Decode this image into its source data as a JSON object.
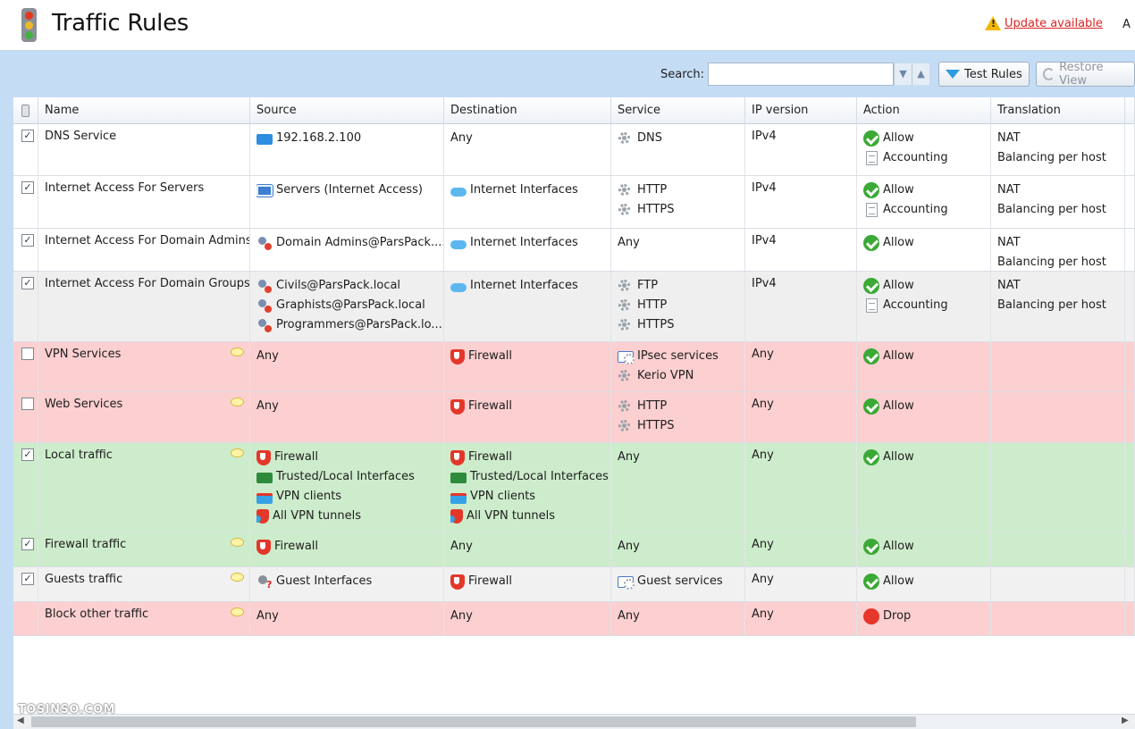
{
  "header": {
    "title": "Traffic Rules",
    "update_link": "Update available",
    "cut_text": "A"
  },
  "toolbar": {
    "search_label": "Search:",
    "search_value": "",
    "test_rules": "Test Rules",
    "restore_view": "Restore View"
  },
  "columns": [
    "Name",
    "Source",
    "Destination",
    "Service",
    "IP version",
    "Action",
    "Translation"
  ],
  "rows": [
    {
      "name": "DNS Service",
      "checked": true,
      "source": [
        "192.168.2.100"
      ],
      "destination": [
        "Any"
      ],
      "service": [
        "DNS"
      ],
      "ip": "IPv4",
      "action": [
        "Allow",
        "Accounting"
      ],
      "translation": [
        "NAT",
        "Balancing per host"
      ]
    },
    {
      "name": "Internet Access For Servers",
      "checked": true,
      "source": [
        "Servers (Internet Access)"
      ],
      "destination": [
        "Internet Interfaces"
      ],
      "service": [
        "HTTP",
        "HTTPS"
      ],
      "ip": "IPv4",
      "action": [
        "Allow",
        "Accounting"
      ],
      "translation": [
        "NAT",
        "Balancing per host"
      ]
    },
    {
      "name": "Internet Access For Domain Admins",
      "checked": true,
      "source": [
        "Domain Admins@ParsPack...."
      ],
      "destination": [
        "Internet Interfaces"
      ],
      "service": [
        "Any"
      ],
      "ip": "IPv4",
      "action": [
        "Allow"
      ],
      "translation": [
        "NAT",
        "Balancing per host"
      ]
    },
    {
      "name": "Internet Access For Domain Groups",
      "checked": true,
      "source": [
        "Civils@ParsPack.local",
        "Graphists@ParsPack.local",
        "Programmers@ParsPack.lo..."
      ],
      "destination": [
        "Internet Interfaces"
      ],
      "service": [
        "FTP",
        "HTTP",
        "HTTPS"
      ],
      "ip": "IPv4",
      "action": [
        "Allow",
        "Accounting"
      ],
      "translation": [
        "NAT",
        "Balancing per host"
      ]
    },
    {
      "name": "VPN Services",
      "checked": false,
      "source": [
        "Any"
      ],
      "destination": [
        "Firewall"
      ],
      "service": [
        "IPsec services",
        "Kerio VPN"
      ],
      "ip": "Any",
      "action": [
        "Allow"
      ],
      "translation": []
    },
    {
      "name": "Web Services",
      "checked": false,
      "source": [
        "Any"
      ],
      "destination": [
        "Firewall"
      ],
      "service": [
        "HTTP",
        "HTTPS"
      ],
      "ip": "Any",
      "action": [
        "Allow"
      ],
      "translation": []
    },
    {
      "name": "Local traffic",
      "checked": true,
      "source": [
        "Firewall",
        "Trusted/Local Interfaces",
        "VPN clients",
        "All VPN tunnels"
      ],
      "destination": [
        "Firewall",
        "Trusted/Local Interfaces",
        "VPN clients",
        "All VPN tunnels"
      ],
      "service": [
        "Any"
      ],
      "ip": "Any",
      "action": [
        "Allow"
      ],
      "translation": []
    },
    {
      "name": "Firewall traffic",
      "checked": true,
      "source": [
        "Firewall"
      ],
      "destination": [
        "Any"
      ],
      "service": [
        "Any"
      ],
      "ip": "Any",
      "action": [
        "Allow"
      ],
      "translation": []
    },
    {
      "name": "Guests traffic",
      "checked": true,
      "source": [
        "Guest Interfaces"
      ],
      "destination": [
        "Firewall"
      ],
      "service": [
        "Guest services"
      ],
      "ip": "Any",
      "action": [
        "Allow"
      ],
      "translation": []
    },
    {
      "name": "Block other traffic",
      "checked": null,
      "source": [
        "Any"
      ],
      "destination": [
        "Any"
      ],
      "service": [
        "Any"
      ],
      "ip": "Any",
      "action": [
        "Drop"
      ],
      "translation": []
    }
  ],
  "watermark": "TOSINSO.COM",
  "colors": {
    "accent": "#c5dcf5",
    "row_red": "#fccfd0",
    "row_green": "#cdeccb",
    "allow": "#3aa935",
    "drop": "#e5382a"
  }
}
